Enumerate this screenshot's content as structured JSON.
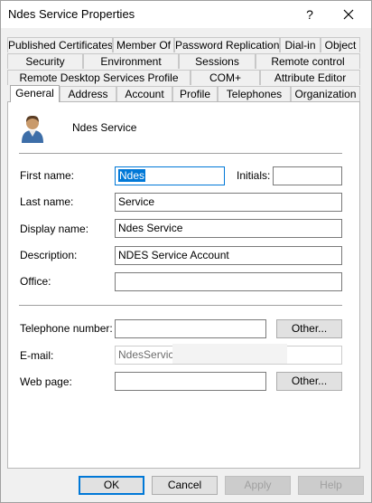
{
  "window": {
    "title": "Ndes Service Properties",
    "help_glyph": "?"
  },
  "tabs": {
    "row1": [
      "Published Certificates",
      "Member Of",
      "Password Replication",
      "Dial-in",
      "Object"
    ],
    "row2": [
      "Security",
      "Environment",
      "Sessions",
      "Remote control"
    ],
    "row3": [
      "Remote Desktop Services Profile",
      "COM+",
      "Attribute Editor"
    ],
    "row4": [
      "General",
      "Address",
      "Account",
      "Profile",
      "Telephones",
      "Organization"
    ],
    "active": "General"
  },
  "header": {
    "object_name": "Ndes Service",
    "icon": "user-icon"
  },
  "form": {
    "first_name_label": "First name:",
    "first_name_value": "Ndes",
    "initials_label": "Initials:",
    "initials_value": "",
    "last_name_label": "Last name:",
    "last_name_value": "Service",
    "display_name_label": "Display name:",
    "display_name_value": "Ndes Service",
    "description_label": "Description:",
    "description_value": "NDES Service Account",
    "office_label": "Office:",
    "office_value": "",
    "telephone_label": "Telephone number:",
    "telephone_value": "",
    "email_label": "E-mail:",
    "email_value": "NdesService",
    "webpage_label": "Web page:",
    "webpage_value": "",
    "other_button_label": "Other..."
  },
  "footer": {
    "ok": "OK",
    "cancel": "Cancel",
    "apply": "Apply",
    "help": "Help"
  },
  "colors": {
    "accent": "#0078d7",
    "dialog_bg": "#f0f0f0",
    "panel_bg": "#ffffff"
  }
}
